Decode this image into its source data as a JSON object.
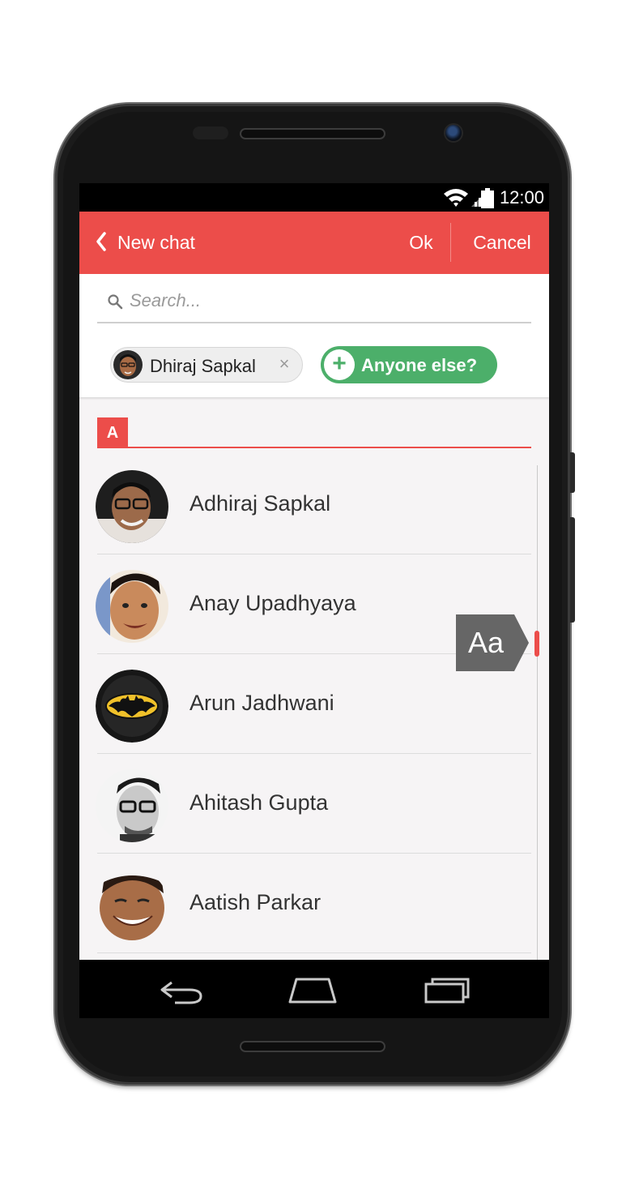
{
  "status_bar": {
    "time": "12:00"
  },
  "app_bar": {
    "title": "New chat",
    "ok_label": "Ok",
    "cancel_label": "Cancel"
  },
  "search": {
    "placeholder": "Search..."
  },
  "selected_chip": {
    "label": "Dhiraj Sapkal",
    "remove_symbol": "×"
  },
  "add_button": {
    "label": "Anyone else?",
    "symbol": "+"
  },
  "section": {
    "letter": "A"
  },
  "contacts": [
    {
      "name": "Adhiraj Sapkal"
    },
    {
      "name": "Anay Upadhyaya"
    },
    {
      "name": "Arun Jadhwani"
    },
    {
      "name": "Ahitash Gupta"
    },
    {
      "name": "Aatish Parkar"
    }
  ],
  "fast_scroll": {
    "label": "Aa"
  },
  "colors": {
    "accent": "#ec4d4a",
    "green": "#4caf6a"
  },
  "icons": [
    "wifi-icon",
    "signal-icon",
    "battery-icon",
    "chevron-left-icon",
    "search-icon",
    "plus-icon",
    "close-icon",
    "back-nav-icon",
    "home-nav-icon",
    "recents-nav-icon"
  ]
}
